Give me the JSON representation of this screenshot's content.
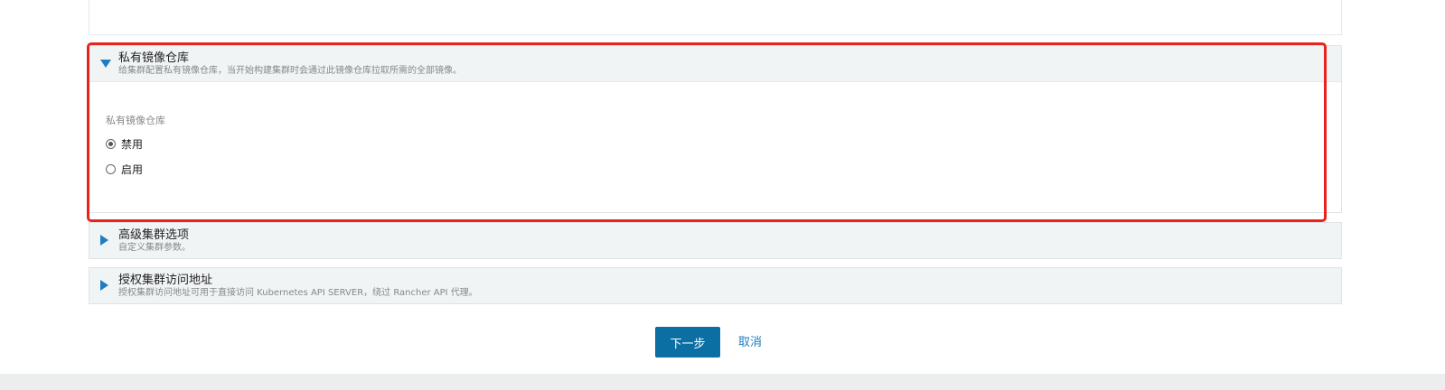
{
  "sections": {
    "registry": {
      "title": "私有镜像仓库",
      "description": "给集群配置私有镜像仓库，当开始构建集群时会通过此镜像仓库拉取所需的全部镜像。",
      "field_label": "私有镜像仓库",
      "options": [
        {
          "label": "禁用",
          "checked": true
        },
        {
          "label": "启用",
          "checked": false
        }
      ]
    },
    "advanced": {
      "title": "高级集群选项",
      "description": "自定义集群参数。"
    },
    "authorized_endpoint": {
      "title": "授权集群访问地址",
      "description": "授权集群访问地址可用于直接访问 Kubernetes API SERVER，绕过 Rancher API 代理。"
    }
  },
  "actions": {
    "next_label": "下一步",
    "cancel_label": "取消"
  },
  "colors": {
    "accent": "#1f7dc1",
    "primary_button": "#0b6fa4",
    "highlight_border": "#e8231e",
    "header_bg": "#f1f4f5"
  },
  "icons": {
    "expanded": "triangle-down-icon",
    "collapsed": "triangle-right-icon"
  }
}
